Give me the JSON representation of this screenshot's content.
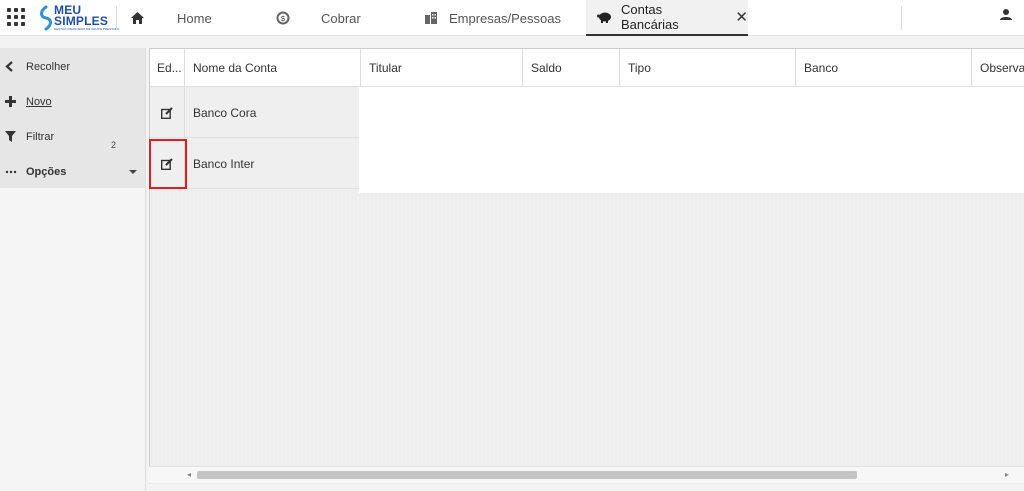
{
  "topbar": {
    "logo_line1": "MEU",
    "logo_line2": "SIMPLES",
    "logo_sub": "GESTÃO FINANCEIRA DE GRUPO PRESTADO",
    "tabs": [
      {
        "label": "Home",
        "icon": "home-icon"
      },
      {
        "label": "Cobrar",
        "icon": "dollar-coin-icon"
      },
      {
        "label": "Empresas/Pessoas",
        "icon": "buildings-icon"
      },
      {
        "label": "Contas Bancárias",
        "icon": "piggy-bank-icon",
        "active": true,
        "close": "✕"
      }
    ]
  },
  "sidebar": {
    "items": [
      {
        "label": "Recolher",
        "icon": "chevron-left-icon"
      },
      {
        "label": "Novo",
        "icon": "plus-icon"
      },
      {
        "label": "Filtrar",
        "icon": "filter-icon"
      },
      {
        "label": "Opções",
        "icon": "more-icon"
      }
    ],
    "filter_count": "2"
  },
  "table": {
    "columns": [
      "Ed...",
      "Nome da Conta",
      "Titular",
      "Saldo",
      "Tipo",
      "Banco",
      "Observa"
    ],
    "rows": [
      {
        "name": "Banco Cora"
      },
      {
        "name": "Banco Inter"
      }
    ]
  },
  "colors": {
    "accent": "#1f4fa0",
    "highlight": "#e02020"
  }
}
